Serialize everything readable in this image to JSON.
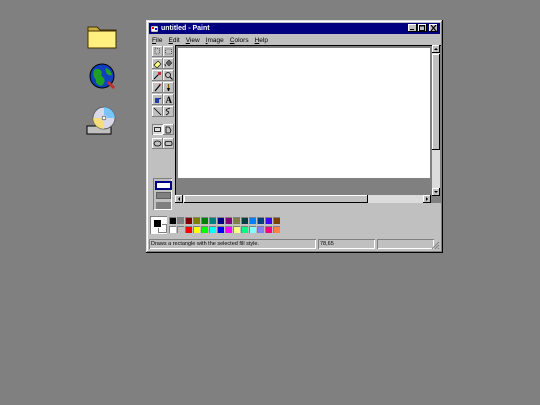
{
  "window": {
    "title": "untitled - Paint"
  },
  "menu": [
    "File",
    "Edit",
    "View",
    "Image",
    "Colors",
    "Help"
  ],
  "tools": [
    "free-form-select",
    "select",
    "eraser",
    "fill",
    "pick-color",
    "magnifier",
    "pencil",
    "brush",
    "airbrush",
    "text",
    "line",
    "curve",
    "rectangle",
    "polygon",
    "ellipse",
    "rounded-rectangle"
  ],
  "selected_tool": "rectangle",
  "colors": {
    "foreground": "#000000",
    "background": "#ffffff",
    "palette_top": [
      "#000000",
      "#808080",
      "#800000",
      "#808000",
      "#008000",
      "#008080",
      "#000080",
      "#800080",
      "#808040",
      "#004040",
      "#0080ff",
      "#004080",
      "#4000ff",
      "#804000"
    ],
    "palette_bottom": [
      "#ffffff",
      "#c0c0c0",
      "#ff0000",
      "#ffff00",
      "#00ff00",
      "#00ffff",
      "#0000ff",
      "#ff00ff",
      "#ffff80",
      "#00ff80",
      "#80ffff",
      "#8080ff",
      "#ff0080",
      "#ff8040"
    ]
  },
  "status": {
    "message": "Draws a rectangle with the selected fill style.",
    "coords": "78,65"
  }
}
